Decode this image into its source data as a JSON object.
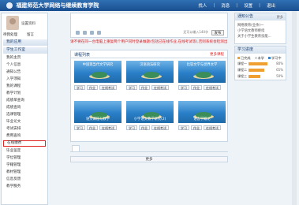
{
  "header": {
    "site_title": "福建师范大学网络与继续教育学院",
    "nav": [
      "找人",
      "消息",
      "设置",
      "退出"
    ],
    "user_label": "退出"
  },
  "profile": {
    "links": [
      "设置资料"
    ],
    "sub": [
      "待我处理",
      "留言"
    ]
  },
  "sidebar": {
    "group1": "我的应用",
    "group2": "学生工作室",
    "items": [
      "我的主页",
      "个人信息",
      "通知公告",
      "入学须知",
      "我的课程",
      "教学计划",
      "成绩单查询",
      "成绩查询",
      "选课管理",
      "毕业论文",
      "考试安排",
      "费用查询",
      "在线缴费",
      "毕业鉴定",
      "学位管理",
      "学籍管理",
      "教材管理",
      "信息反馈",
      "教学服务"
    ],
    "active_index": 12
  },
  "compose": {
    "send_label": "发布",
    "count_label": "还可以输入140字"
  },
  "notice_text": "请不要在同一台电脑上重复两个用户同时登录做题(包括已在线作业,在线考试等),否则系统会检测出非法",
  "courses": {
    "title": "课程列表",
    "more": "更多课程",
    "cards": [
      {
        "title": "中国现当代文学研究",
        "btns": [
          "学习",
          "作业",
          "在线考试"
        ]
      },
      {
        "title": "汉语语法研究",
        "btns": [
          "学习",
          "作业",
          "在线考试"
        ]
      },
      {
        "title": "比较文学与世界文学",
        "btns": [
          "学习",
          "作业",
          "在线考试"
        ]
      },
      {
        "title": "语文课程与教学",
        "btns": [
          "学习",
          "作业",
          "在线考试"
        ]
      },
      {
        "title": "小学语文教学研究(2)",
        "btns": [
          "学习",
          "作业",
          "在线考试"
        ]
      },
      {
        "title": "语言学概论",
        "btns": [
          "学习",
          "作业",
          "在线考试"
        ]
      }
    ]
  },
  "more_label": "更多",
  "right": {
    "announce_title": "通知公告",
    "announce_more": "更多",
    "announce_lines": [
      "网络教育(业余)一",
      "小学语文教师继续",
      "关于小学生教育技能..."
    ],
    "progress_title": "学习进度",
    "legend": [
      {
        "label": "已完成",
        "color": "#f0a030"
      },
      {
        "label": "未学",
        "color": "#d9d9d9"
      },
      {
        "label": "学习中",
        "color": "#3b7fc4"
      }
    ],
    "bars": [
      {
        "label": "课程一",
        "value": "80%",
        "fraction": 0.8
      },
      {
        "label": "课程二",
        "value": "65%",
        "fraction": 0.65
      },
      {
        "label": "课程三",
        "value": "50%",
        "fraction": 0.5
      }
    ]
  }
}
